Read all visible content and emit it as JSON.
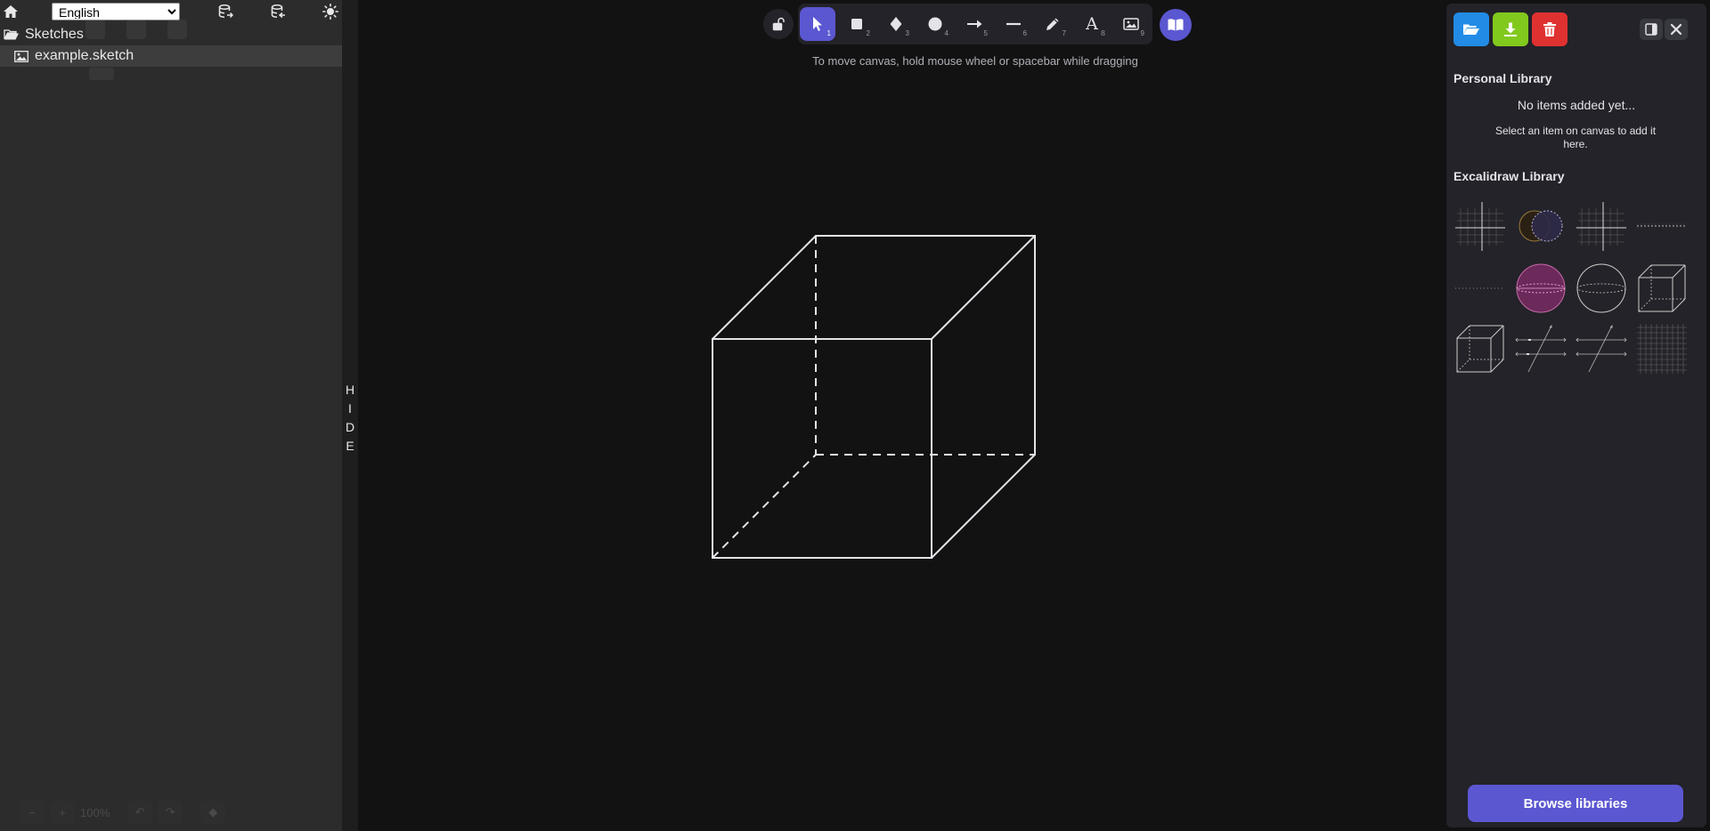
{
  "sidebar": {
    "language": "English",
    "language_options": [
      "English"
    ],
    "tree": {
      "folder_label": "Sketches",
      "file_label": "example.sketch"
    },
    "zoom_label": "100%"
  },
  "hide_label": [
    "H",
    "I",
    "D",
    "E"
  ],
  "toolbar": {
    "tools": [
      {
        "name": "selection",
        "num": "1"
      },
      {
        "name": "rectangle",
        "num": "2"
      },
      {
        "name": "diamond",
        "num": "3"
      },
      {
        "name": "ellipse",
        "num": "4"
      },
      {
        "name": "arrow",
        "num": "5"
      },
      {
        "name": "line",
        "num": "6"
      },
      {
        "name": "draw",
        "num": "7"
      },
      {
        "name": "text",
        "num": "8"
      },
      {
        "name": "image",
        "num": "9"
      }
    ],
    "active_tool": "selection",
    "text_tool_glyph": "A"
  },
  "canvas": {
    "hint": "To move canvas, hold mouse wheel or spacebar while dragging"
  },
  "library": {
    "personal_title": "Personal Library",
    "no_items": "No items added yet...",
    "no_items_hint": "Select an item on canvas to add it here.",
    "excalidraw_title": "Excalidraw Library",
    "browse_label": "Browse libraries",
    "items": [
      "axes-grid",
      "venn-diagram",
      "axes-grid-2",
      "dashed-line",
      "dotted-line",
      "pink-sphere",
      "sphere-outline",
      "cube-outline",
      "cube-outline-2",
      "parallel-lines-transversal",
      "parallel-lines-transversal-2",
      "grid"
    ]
  },
  "colors": {
    "accent": "#5b57d1",
    "open_button": "#228be6",
    "save_button": "#82c91e",
    "delete_button": "#e03131"
  }
}
